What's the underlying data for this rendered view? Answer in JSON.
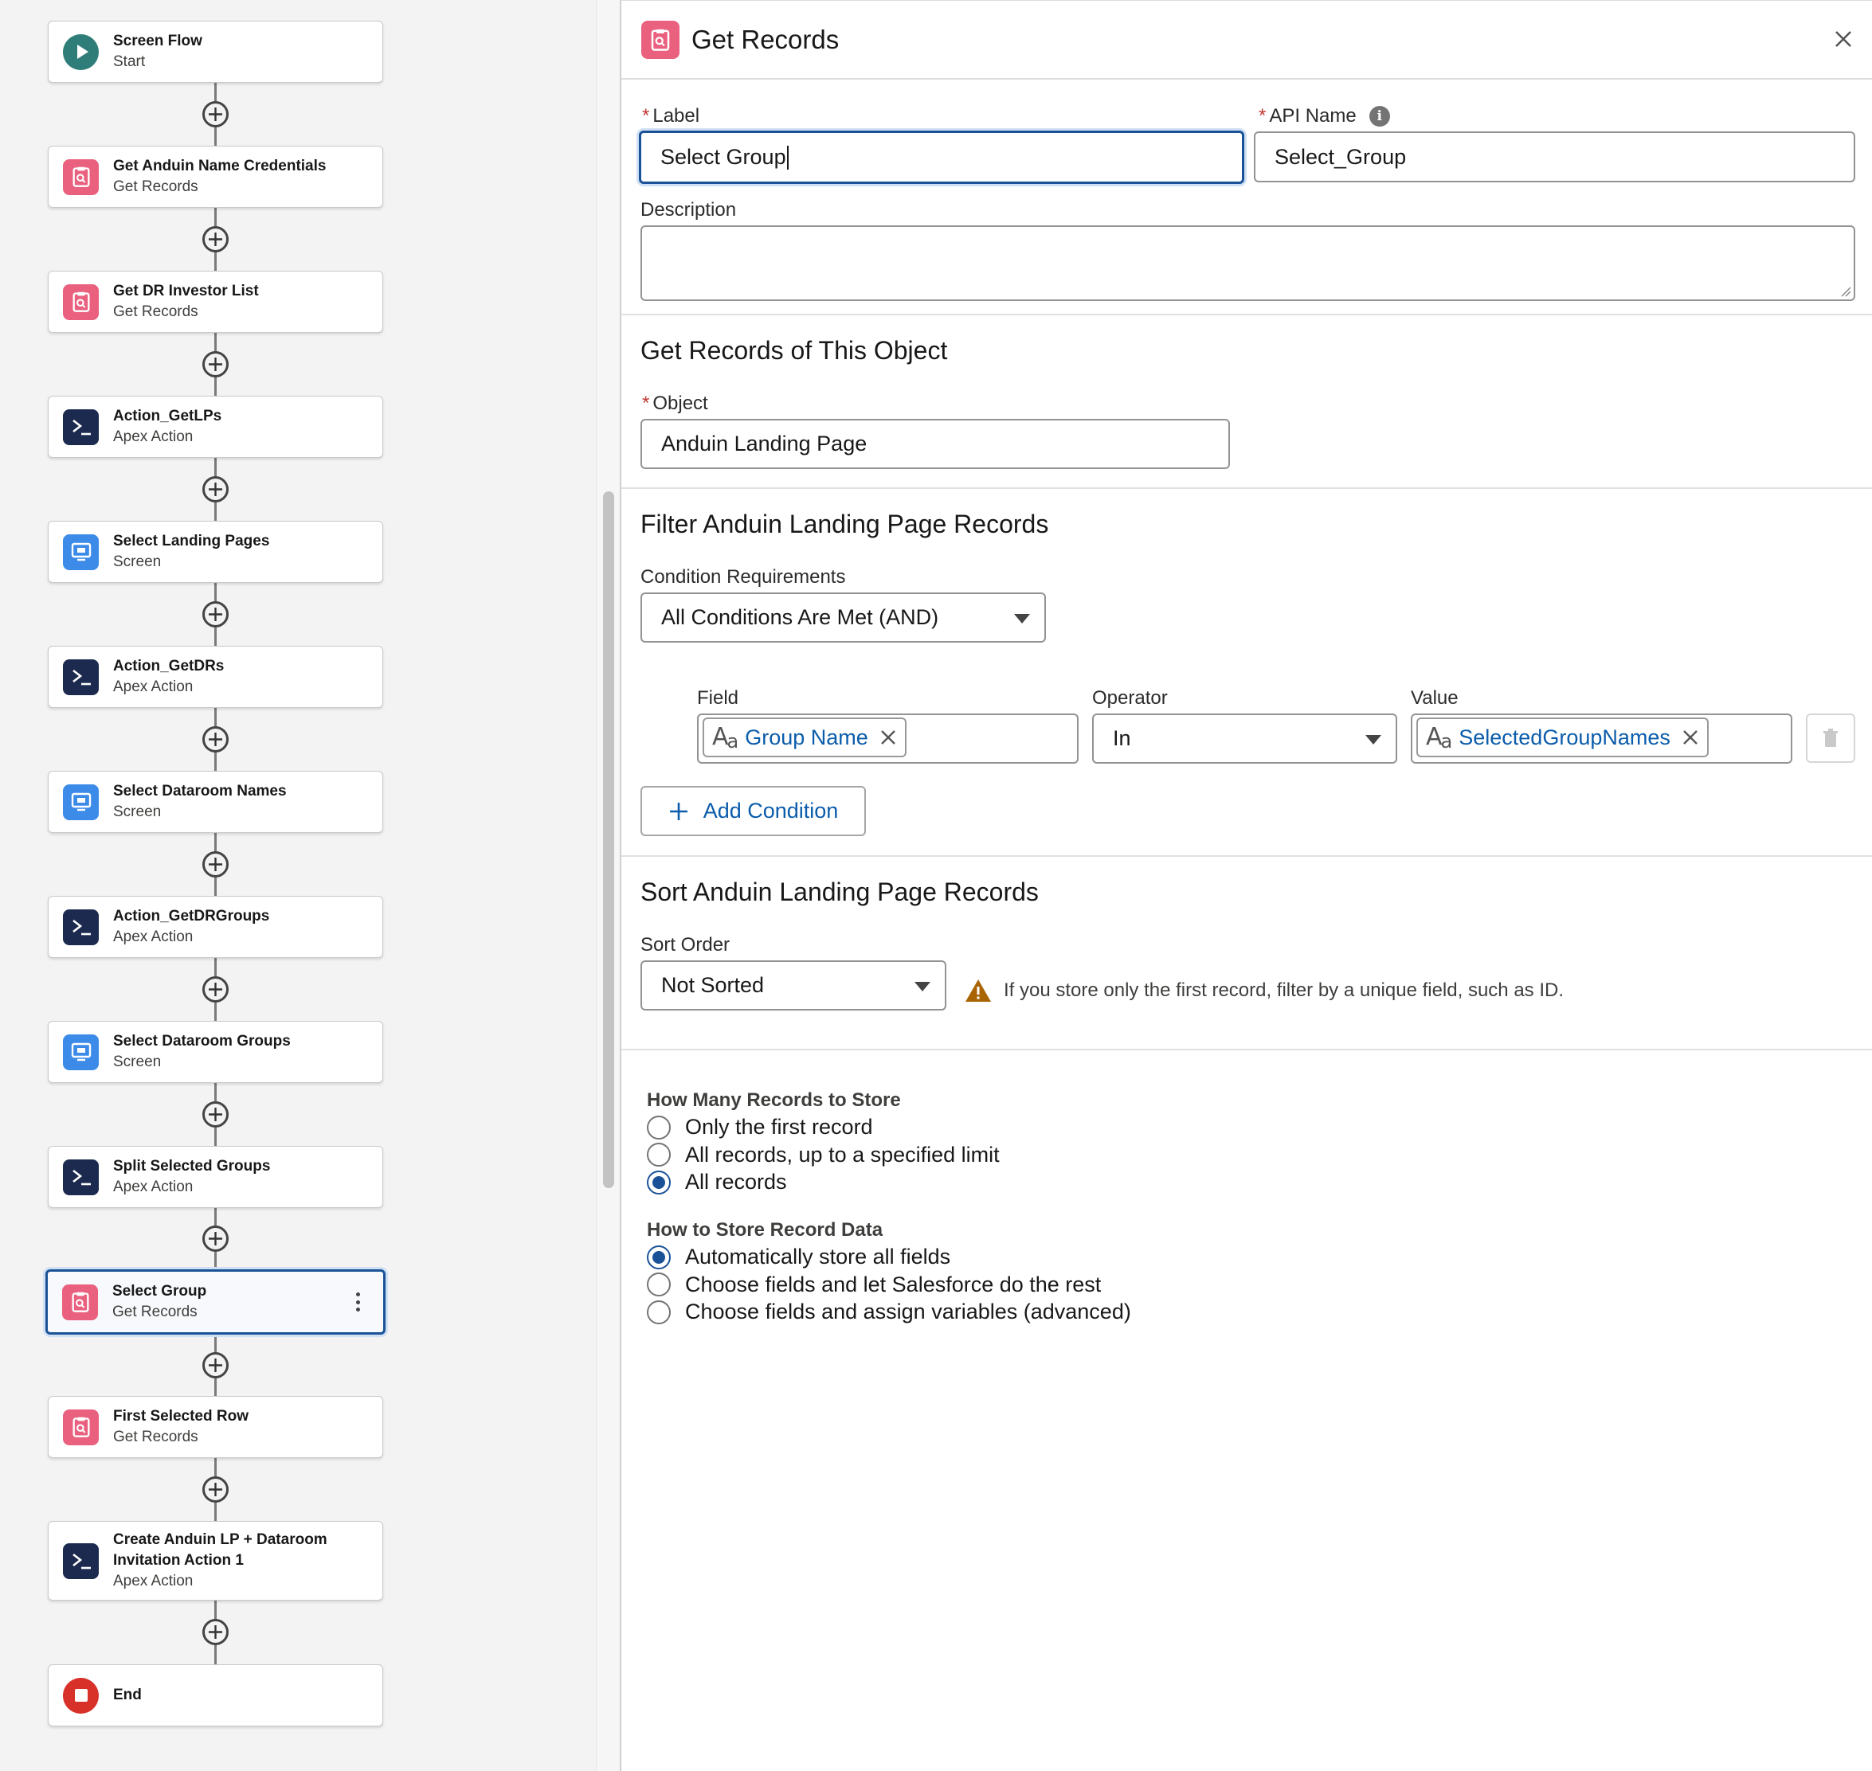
{
  "flow": {
    "nodes": [
      {
        "title": "Screen Flow",
        "subtitle": "Start",
        "icon": "start-icon"
      },
      {
        "title": "Get Anduin Name Credentials",
        "subtitle": "Get Records",
        "icon": "get-records-icon"
      },
      {
        "title": "Get DR Investor List",
        "subtitle": "Get Records",
        "icon": "get-records-icon"
      },
      {
        "title": "Action_GetLPs",
        "subtitle": "Apex Action",
        "icon": "apex-action-icon"
      },
      {
        "title": "Select Landing Pages",
        "subtitle": "Screen",
        "icon": "screen-icon"
      },
      {
        "title": "Action_GetDRs",
        "subtitle": "Apex Action",
        "icon": "apex-action-icon"
      },
      {
        "title": "Select Dataroom Names",
        "subtitle": "Screen",
        "icon": "screen-icon"
      },
      {
        "title": "Action_GetDRGroups",
        "subtitle": "Apex Action",
        "icon": "apex-action-icon"
      },
      {
        "title": "Select Dataroom Groups",
        "subtitle": "Screen",
        "icon": "screen-icon"
      },
      {
        "title": "Split Selected Groups",
        "subtitle": "Apex Action",
        "icon": "apex-action-icon"
      },
      {
        "title": "Select Group",
        "subtitle": "Get Records",
        "icon": "get-records-icon",
        "selected": true
      },
      {
        "title": "First Selected Row",
        "subtitle": "Get Records",
        "icon": "get-records-icon"
      },
      {
        "title": "Create Anduin LP + Dataroom",
        "title2": "Invitation Action 1",
        "subtitle": "Apex Action",
        "icon": "apex-action-icon"
      },
      {
        "title": "End",
        "subtitle": "",
        "icon": "end-icon"
      }
    ]
  },
  "panel": {
    "title": "Get Records",
    "label_label": "Label",
    "label_value": "Select Group",
    "api_label": "API Name",
    "api_value": "Select_Group",
    "description_label": "Description",
    "description_value": "",
    "object_section_title": "Get Records of This Object",
    "object_label": "Object",
    "object_value": "Anduin Landing Page",
    "filter_section_title": "Filter Anduin Landing Page Records",
    "condition_req_label": "Condition Requirements",
    "condition_req_value": "All Conditions Are Met (AND)",
    "field_label": "Field",
    "field_value": "Group Name",
    "operator_label": "Operator",
    "operator_value": "In",
    "value_label": "Value",
    "value_value": "SelectedGroupNames",
    "add_condition": "Add Condition",
    "sort_section_title": "Sort Anduin Landing Page Records",
    "sort_order_label": "Sort Order",
    "sort_order_value": "Not Sorted",
    "sort_warning": "If you store only the first record, filter by a unique field, such as ID.",
    "how_many_title": "How Many Records to Store",
    "how_many_options": [
      "Only the first record",
      "All records, up to a specified limit",
      "All records"
    ],
    "how_many_selected": 2,
    "how_store_title": "How to Store Record Data",
    "how_store_options": [
      "Automatically store all fields",
      "Choose fields and let Salesforce do the rest",
      "Choose fields and assign variables (advanced)"
    ],
    "how_store_selected": 0
  },
  "colors": {
    "get_records": "#e9617f",
    "apex_action": "#1b2a4e",
    "screen": "#3c8be8",
    "start": "#2e7d79",
    "end": "#d8312a",
    "link": "#0b5cab",
    "focus": "#1b5297"
  }
}
